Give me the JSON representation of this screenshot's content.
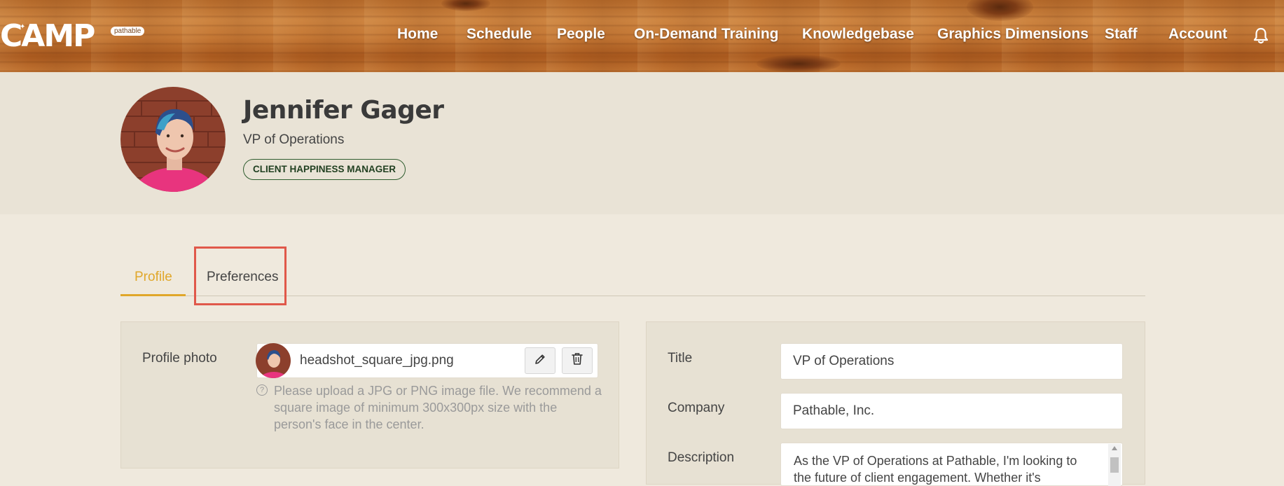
{
  "header": {
    "logo_text": "CAMP",
    "logo_badge": "pathable",
    "nav": [
      "Home",
      "Schedule",
      "People",
      "On-Demand Training",
      "Knowledgebase",
      "Graphics Dimensions",
      "Staff",
      "Account"
    ],
    "icons": {
      "notifications": "bell-icon"
    }
  },
  "profile_header": {
    "name": "Jennifer Gager",
    "title": "VP of Operations",
    "role_badge": "CLIENT HAPPINESS MANAGER"
  },
  "tabs": [
    {
      "label": "Profile",
      "active": true
    },
    {
      "label": "Preferences",
      "active": false,
      "highlighted": true
    }
  ],
  "photo_section": {
    "label": "Profile photo",
    "file_name": "headshot_square_jpg.png",
    "help_text": "Please upload a JPG or PNG image file. We recommend a square image of minimum 300x300px size with the person's face in the center.",
    "icons": {
      "edit": "pencil-icon",
      "delete": "trash-icon",
      "help": "question-circle-icon"
    }
  },
  "fields": {
    "title": {
      "label": "Title",
      "value": "VP of Operations"
    },
    "company": {
      "label": "Company",
      "value": "Pathable, Inc."
    },
    "description": {
      "label": "Description",
      "value": "As the VP of Operations at Pathable,  I'm looking to the future of client engagement.  Whether it's"
    }
  },
  "colors": {
    "accent": "#e0a72a",
    "highlight_box": "#e0584a",
    "badge_border": "#2f5d2f",
    "page_bg": "#efe9dd",
    "hero_bg": "#e9e3d6"
  }
}
